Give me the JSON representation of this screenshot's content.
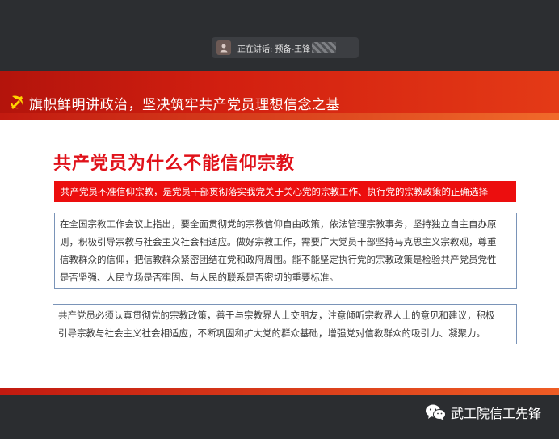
{
  "meeting": {
    "speaker_label": "正在讲话: 预备-王锋"
  },
  "slide": {
    "header_title": "旗帜鲜明讲政治，坚决筑牢共产党员理想信念之基",
    "heading": "共产党员为什么不能信仰宗教",
    "banner": "共产党员不准信仰宗教，是党员干部贯彻落实我党关于关心党的宗教工作、执行党的宗教政策的正确选择",
    "box1_lines": [
      "在全国宗教工作会议上指出，要全面贯彻党的宗教信仰自由政策，依法管理宗教事务，坚持独立自主自办原",
      "则，积极引导宗教与社会主义社会相适应。做好宗教工作，需要广大党员干部坚持马克思主义宗教观，尊重",
      "信教群众的信仰，把信教群众紧密团结在党和政府周围。能不能坚定执行党的宗教政策是检验共产党员党性",
      "是否坚强、人民立场是否牢固、与人民的联系是否密切的重要标准。"
    ],
    "box2_lines": [
      "共产党员必须认真贯彻党的宗教政策，善于与宗教界人士交朋友，注意倾听宗教界人士的意见和建议，积极",
      "引导宗教与社会主义社会相适应，不断巩固和扩大党的群众基础，增强党对信教群众的吸引力、凝聚力。"
    ]
  },
  "watermark": {
    "text": "武工院信工先锋",
    "icon": "wechat-icon"
  },
  "colors": {
    "header_red": "#d21f10",
    "heading_red": "#e0121a",
    "banner_red": "#ec0e0e",
    "box_border": "#7a94b8"
  }
}
